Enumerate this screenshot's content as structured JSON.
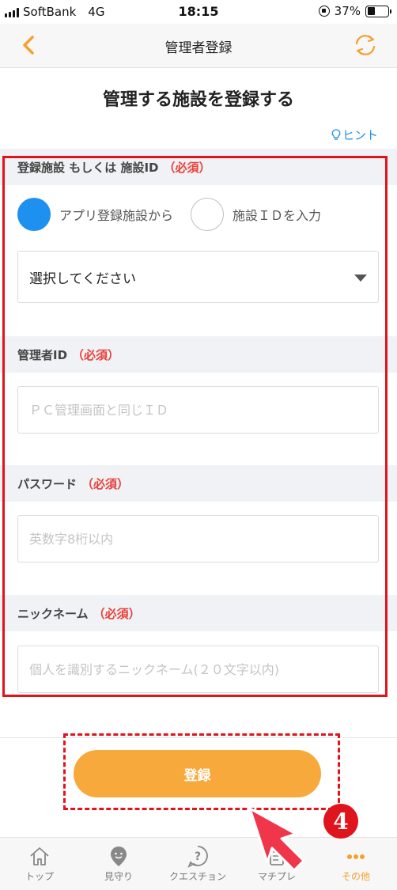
{
  "status_bar": {
    "carrier": "SoftBank",
    "network": "4G",
    "time": "18:15",
    "battery": "37%",
    "battery_level": 0.37
  },
  "nav": {
    "title": "管理者登録",
    "back_icon": "chevron-left-icon",
    "refresh_icon": "refresh-icon"
  },
  "page": {
    "title": "管理する施設を登録する",
    "hint": "ヒント"
  },
  "facility_section": {
    "label": "登録施設 もしくは 施設ID",
    "required": "（必須）",
    "radio_options": [
      {
        "label": "アプリ登録施設から",
        "selected": true
      },
      {
        "label": "施設ＩＤを入力",
        "selected": false
      }
    ],
    "select_value": "選択してください"
  },
  "admin_id": {
    "label": "管理者ID",
    "required": "（必須）",
    "placeholder": "ＰＣ管理画面と同じＩＤ"
  },
  "password": {
    "label": "パスワード",
    "required": "（必須）",
    "placeholder": "英数字8桁以内"
  },
  "nickname": {
    "label": "ニックネーム",
    "required": "（必須）",
    "placeholder": "個人を識別するニックネーム(２０文字以内)"
  },
  "submit_label": "登録",
  "annotation": {
    "step": "4"
  },
  "tabs": [
    {
      "label": "トップ",
      "icon": "home-icon",
      "active": false
    },
    {
      "label": "見守り",
      "icon": "map-pin-icon",
      "active": false
    },
    {
      "label": "クエスチョン",
      "icon": "question-icon",
      "active": false
    },
    {
      "label": "マチプレ",
      "icon": "document-icon",
      "active": false
    },
    {
      "label": "その他",
      "icon": "more-icon",
      "active": true
    }
  ],
  "colors": {
    "accent": "#f8a93c",
    "radio_selected": "#1e90f0",
    "required": "#e8403a",
    "link": "#1e90e8",
    "annotation": "#e0141c"
  }
}
